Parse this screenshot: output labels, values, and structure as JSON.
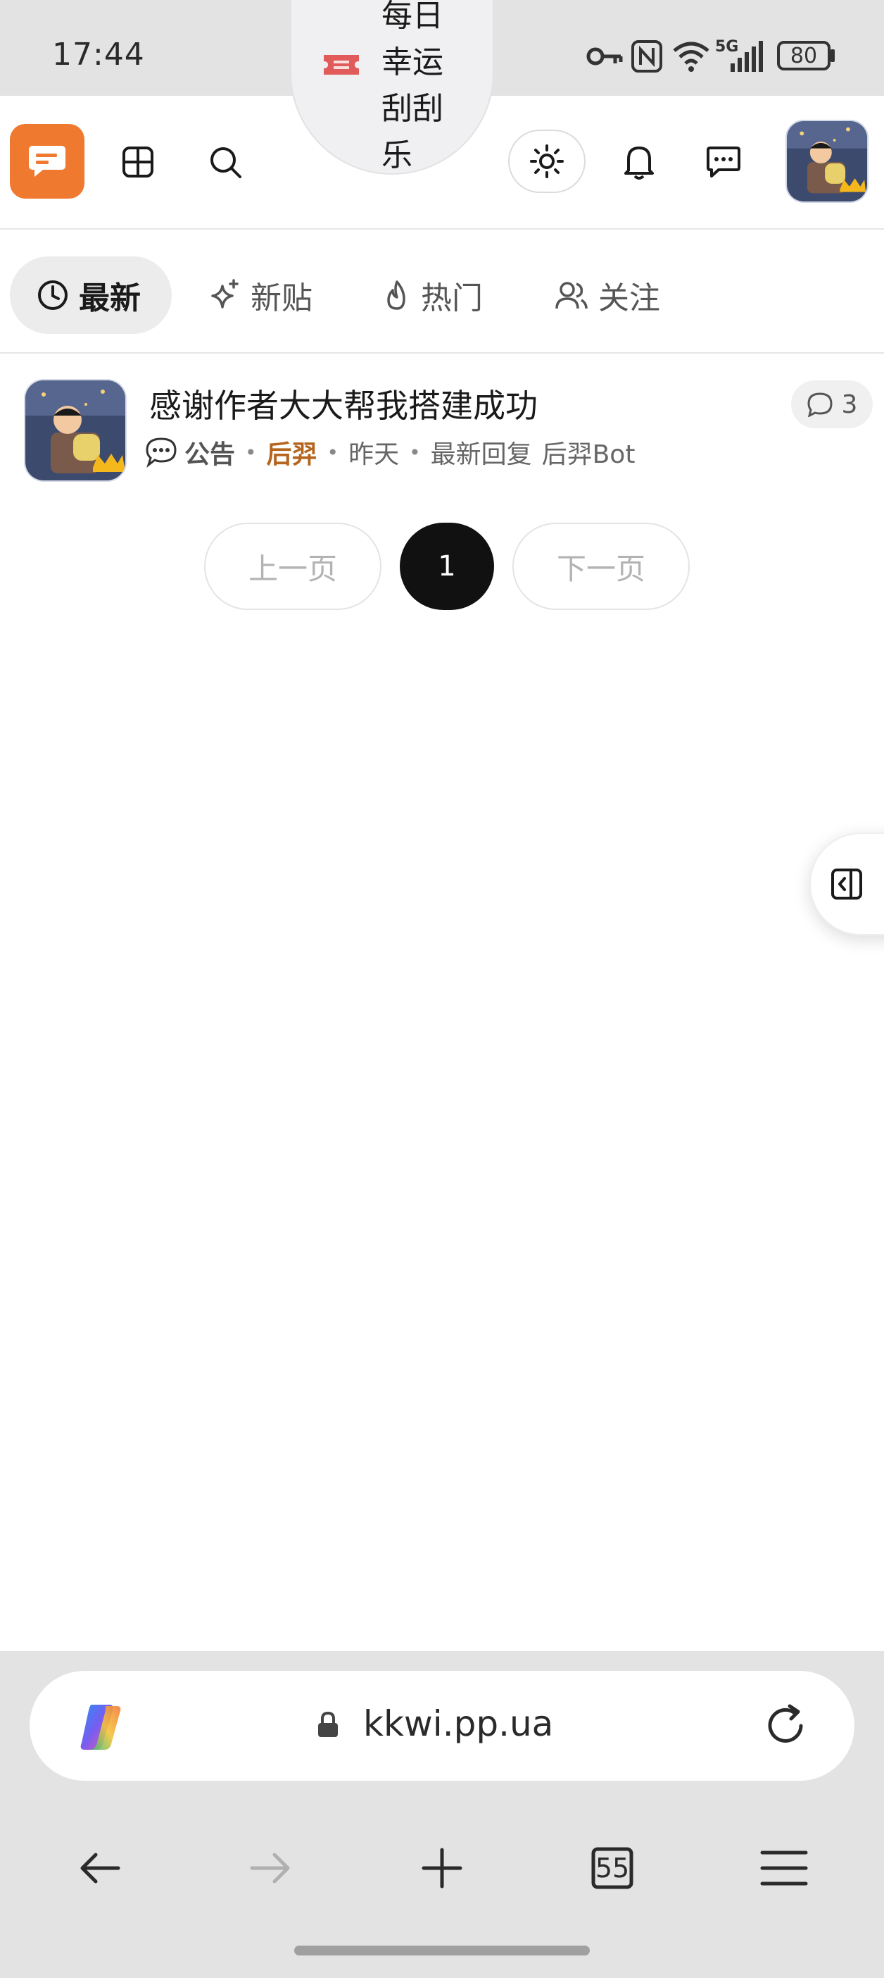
{
  "status_bar": {
    "time": "17:44",
    "network": "5G",
    "battery": "80",
    "icons": [
      "key-icon",
      "nfc-icon",
      "wifi-icon",
      "signal-icon",
      "battery-icon"
    ]
  },
  "header": {
    "logo_icon": "forum-chat-icon",
    "brand_color": "#ef7a2f",
    "lucky_label": "每日幸运刮刮乐",
    "icons": [
      "grid-icon",
      "search-icon",
      "ticket-icon",
      "sun-icon",
      "bell-icon",
      "message-icon"
    ]
  },
  "tabs": [
    {
      "label": "最新",
      "active": true,
      "icon": "clock-icon"
    },
    {
      "label": "新贴",
      "active": false,
      "icon": "sparkle-icon"
    },
    {
      "label": "热门",
      "active": false,
      "icon": "flame-icon"
    },
    {
      "label": "关注",
      "active": false,
      "icon": "users-icon"
    }
  ],
  "topic": {
    "title": "感谢作者大大帮我搭建成功",
    "category": "公告",
    "author": "后羿",
    "time": "昨天",
    "last_reply_label": "最新回复",
    "last_reply_user": "后羿Bot",
    "reply_count": "3",
    "separator": "•"
  },
  "pagination": {
    "prev": "上一页",
    "current": "1",
    "next": "下一页"
  },
  "browser": {
    "url": "kkwi.pp.ua",
    "tab_count": "55"
  }
}
